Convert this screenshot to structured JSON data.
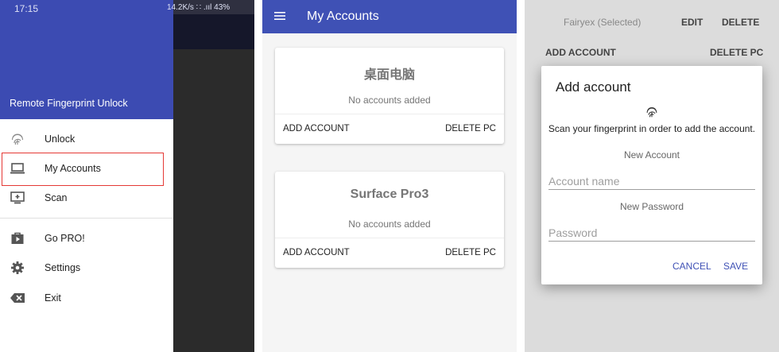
{
  "left_panel": {
    "status_bar": {
      "time": "17:15",
      "indicators": "14.2K/s ∷ .ııl 43%"
    },
    "drawer_title": "Remote Fingerprint Unlock",
    "nav_items": [
      {
        "label": "Unlock",
        "icon": "fingerprint-icon"
      },
      {
        "label": "My Accounts",
        "icon": "laptop-icon",
        "selected": true
      },
      {
        "label": "Scan",
        "icon": "add-screen-icon"
      },
      {
        "label": "Go PRO!",
        "icon": "shop-icon"
      },
      {
        "label": "Settings",
        "icon": "gear-icon"
      },
      {
        "label": "Exit",
        "icon": "backspace-icon"
      }
    ]
  },
  "middle_panel": {
    "title": "My Accounts",
    "cards": [
      {
        "name": "桌面电脑",
        "empty_text": "No accounts added",
        "add_label": "ADD ACCOUNT",
        "delete_label": "DELETE PC"
      },
      {
        "name": "Surface Pro3",
        "empty_text": "No accounts added",
        "add_label": "ADD ACCOUNT",
        "delete_label": "DELETE PC"
      }
    ]
  },
  "right_panel": {
    "background_rows": {
      "account_name": "Fairyex (Selected)",
      "edit_label": "EDIT",
      "delete_label": "DELETE",
      "add_label": "ADD ACCOUNT",
      "delete_pc_label": "DELETE PC"
    },
    "dialog": {
      "title": "Add account",
      "message": "Scan your fingerprint in order to add the account.",
      "new_account_label": "New Account",
      "account_placeholder": "Account name",
      "new_password_label": "New Password",
      "password_placeholder": "Password",
      "cancel_label": "CANCEL",
      "save_label": "SAVE"
    }
  },
  "colors": {
    "primary": "#3f51b5",
    "drawer_header": "#3c4bb2",
    "highlight_border": "#e53935"
  }
}
